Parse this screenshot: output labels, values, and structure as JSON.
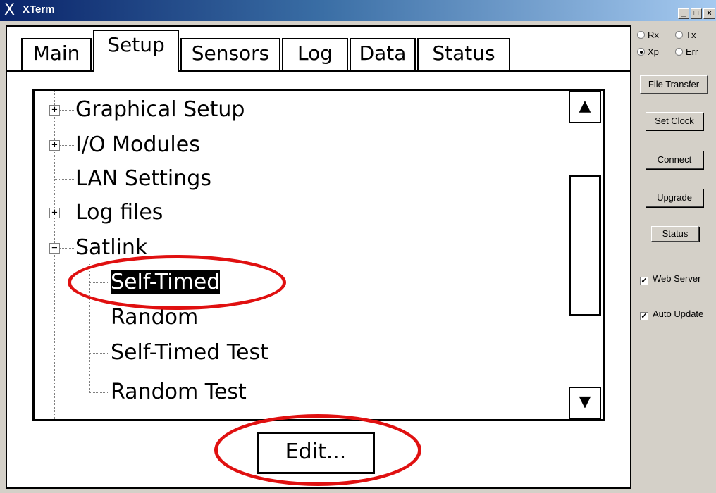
{
  "window": {
    "app_icon": "X",
    "title": "XTerm",
    "controls": {
      "minimize": "_",
      "maximize": "□",
      "close": "×"
    }
  },
  "tabs": [
    {
      "label": "Main",
      "active": false
    },
    {
      "label": "Setup",
      "active": true
    },
    {
      "label": "Sensors",
      "active": false
    },
    {
      "label": "Log",
      "active": false
    },
    {
      "label": "Data",
      "active": false
    },
    {
      "label": "Status",
      "active": false
    }
  ],
  "tree": {
    "items": [
      {
        "label": "Graphical Setup",
        "expander": "+"
      },
      {
        "label": "I/O Modules",
        "expander": "+"
      },
      {
        "label": "LAN Settings",
        "expander": ""
      },
      {
        "label": "Log files",
        "expander": "+"
      },
      {
        "label": "Satlink",
        "expander": "−"
      },
      {
        "label": "Self-Timed",
        "selected": true
      },
      {
        "label": "Random"
      },
      {
        "label": "Self-Timed Test"
      },
      {
        "label": "Random Test"
      }
    ],
    "scroll_up": "▲",
    "scroll_down": "▼"
  },
  "edit_button": "Edit...",
  "side_panel": {
    "radios": [
      {
        "label": "Rx",
        "checked": false
      },
      {
        "label": "Tx",
        "checked": false
      },
      {
        "label": "Xp",
        "checked": true
      },
      {
        "label": "Err",
        "checked": false
      }
    ],
    "buttons": {
      "file_transfer": "File Transfer",
      "set_clock": "Set Clock",
      "connect": "Connect",
      "upgrade": "Upgrade",
      "status": "Status"
    },
    "checkboxes": [
      {
        "label": "Web Server",
        "checked": true
      },
      {
        "label": "Auto Update",
        "checked": true
      }
    ]
  },
  "colors": {
    "annotation_ring": "#e01010",
    "titlebar_start": "#0a246a",
    "titlebar_end": "#a6caf0"
  }
}
